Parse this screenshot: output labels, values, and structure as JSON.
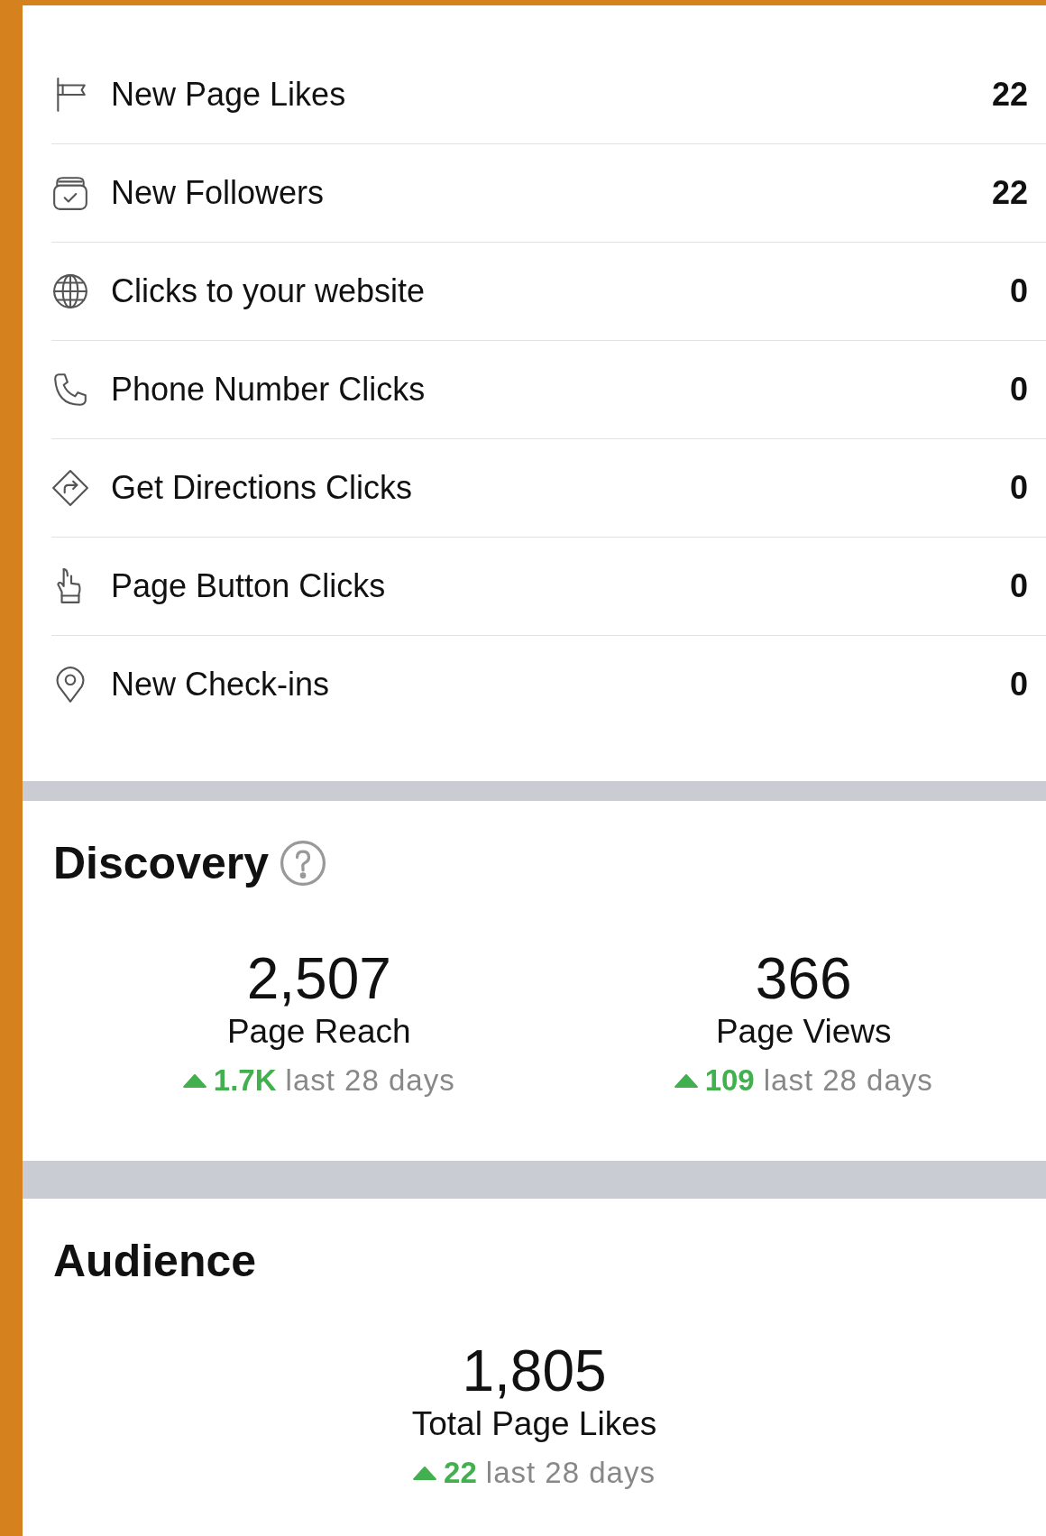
{
  "metrics": [
    {
      "label": "New Page Likes",
      "value": "22"
    },
    {
      "label": "New Followers",
      "value": "22"
    },
    {
      "label": "Clicks to your website",
      "value": "0"
    },
    {
      "label": "Phone Number Clicks",
      "value": "0"
    },
    {
      "label": "Get Directions Clicks",
      "value": "0"
    },
    {
      "label": "Page Button Clicks",
      "value": "0"
    },
    {
      "label": "New Check-ins",
      "value": "0"
    }
  ],
  "discovery": {
    "title": "Discovery",
    "stats": [
      {
        "value": "2,507",
        "label": "Page Reach",
        "change": "1.7K",
        "period": "last 28 days"
      },
      {
        "value": "366",
        "label": "Page Views",
        "change": "109",
        "period": "last 28 days"
      }
    ]
  },
  "audience": {
    "title": "Audience",
    "stats": [
      {
        "value": "1,805",
        "label": "Total Page Likes",
        "change": "22",
        "period": "last 28 days"
      }
    ]
  }
}
